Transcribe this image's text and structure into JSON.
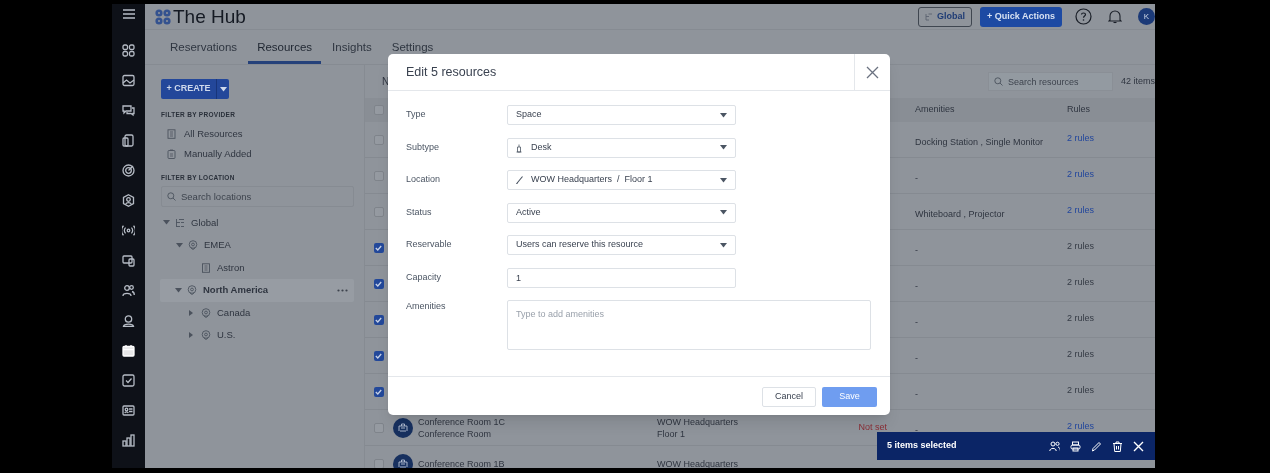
{
  "nav_rail": {
    "items": [
      {
        "selected": false
      },
      {
        "selected": false
      },
      {
        "selected": false
      },
      {
        "selected": false
      },
      {
        "selected": false
      },
      {
        "selected": false
      },
      {
        "selected": false
      },
      {
        "selected": false
      },
      {
        "selected": false
      },
      {
        "selected": false
      },
      {
        "selected": true
      },
      {
        "selected": false
      },
      {
        "selected": false
      },
      {
        "selected": false
      }
    ]
  },
  "header": {
    "logo_text": "The Hub",
    "location_button": "Global",
    "quick_actions_button": "+ Quick Actions",
    "avatar": "K"
  },
  "tabs": [
    {
      "label": "Reservations",
      "selected": false
    },
    {
      "label": "Resources",
      "selected": true
    },
    {
      "label": "Insights",
      "selected": false
    },
    {
      "label": "Settings",
      "selected": false
    }
  ],
  "left_panel": {
    "create_button": "+ CREATE",
    "provider_heading": "FILTER BY PROVIDER",
    "providers": [
      {
        "label": "All Resources"
      },
      {
        "label": "Manually Added"
      }
    ],
    "location_heading": "FILTER BY LOCATION",
    "location_search": {
      "placeholder": "Search locations"
    },
    "tree": [
      {
        "label": "Global",
        "kind": "root",
        "expanded": true,
        "selected": false,
        "children": [
          {
            "label": "EMEA",
            "kind": "region",
            "expanded": true,
            "selected": false,
            "children": [
              {
                "label": "Astron",
                "kind": "building",
                "selected": false
              }
            ]
          },
          {
            "label": "North America",
            "kind": "region",
            "expanded": true,
            "selected": true,
            "children": [
              {
                "label": "Canada",
                "kind": "region",
                "expanded": false,
                "selected": false
              },
              {
                "label": "U.S.",
                "kind": "region",
                "expanded": false,
                "selected": false
              }
            ]
          }
        ]
      }
    ]
  },
  "table": {
    "toolbar_text": "N",
    "search": {
      "placeholder": "Search resources"
    },
    "item_count": "42 items",
    "header_checked": false,
    "columns": [
      {
        "label": "Amenities"
      },
      {
        "label": "Rules"
      }
    ],
    "rows": [
      {
        "checked": false,
        "amenities": "Docking Station , Single Monitor",
        "rules": "2 rules",
        "rules_link": true
      },
      {
        "checked": false,
        "amenities": "-",
        "rules": "2 rules",
        "rules_link": true
      },
      {
        "checked": false,
        "amenities": "Whiteboard , Projector",
        "rules": "2 rules",
        "rules_link": true
      },
      {
        "checked": true,
        "amenities": "-",
        "rules": "2 rules",
        "rules_link": false
      },
      {
        "checked": true,
        "amenities": "-",
        "rules": "2 rules",
        "rules_link": false
      },
      {
        "checked": true,
        "amenities": "-",
        "rules": "2 rules",
        "rules_link": false
      },
      {
        "checked": true,
        "amenities": "-",
        "rules": "2 rules",
        "rules_link": false
      },
      {
        "checked": true,
        "amenities": "-",
        "rules": "2 rules",
        "rules_link": false
      },
      {
        "checked": false,
        "name": "Conference Room 1C",
        "subtitle": "Conference Room",
        "location": "WOW Headquarters",
        "floor": "Floor 1",
        "status": "Not set",
        "amenities": "-",
        "rules": "2 rules",
        "rules_link": true
      },
      {
        "checked": false,
        "name": "Conference Room 1B",
        "location": "WOW Headquarters"
      }
    ]
  },
  "modal": {
    "title": "Edit 5 resources",
    "fields": [
      {
        "label": "Type",
        "kind": "select",
        "value": "Space"
      },
      {
        "label": "Subtype",
        "kind": "select",
        "value": "Desk"
      },
      {
        "label": "Location",
        "kind": "select",
        "value": "WOW Headquarters  /  Floor 1"
      },
      {
        "label": "Status",
        "kind": "select",
        "value": "Active"
      },
      {
        "label": "Reservable",
        "kind": "select",
        "value": "Users can reserve this resource"
      },
      {
        "label": "Capacity",
        "kind": "text",
        "value": "1"
      },
      {
        "label": "Amenities",
        "kind": "tags",
        "placeholder": "Type to add amenities"
      }
    ],
    "cancel_button": "Cancel",
    "save_button": {
      "label": "Save",
      "disabled": true
    }
  },
  "selection_bar": {
    "text": "5 items selected"
  }
}
